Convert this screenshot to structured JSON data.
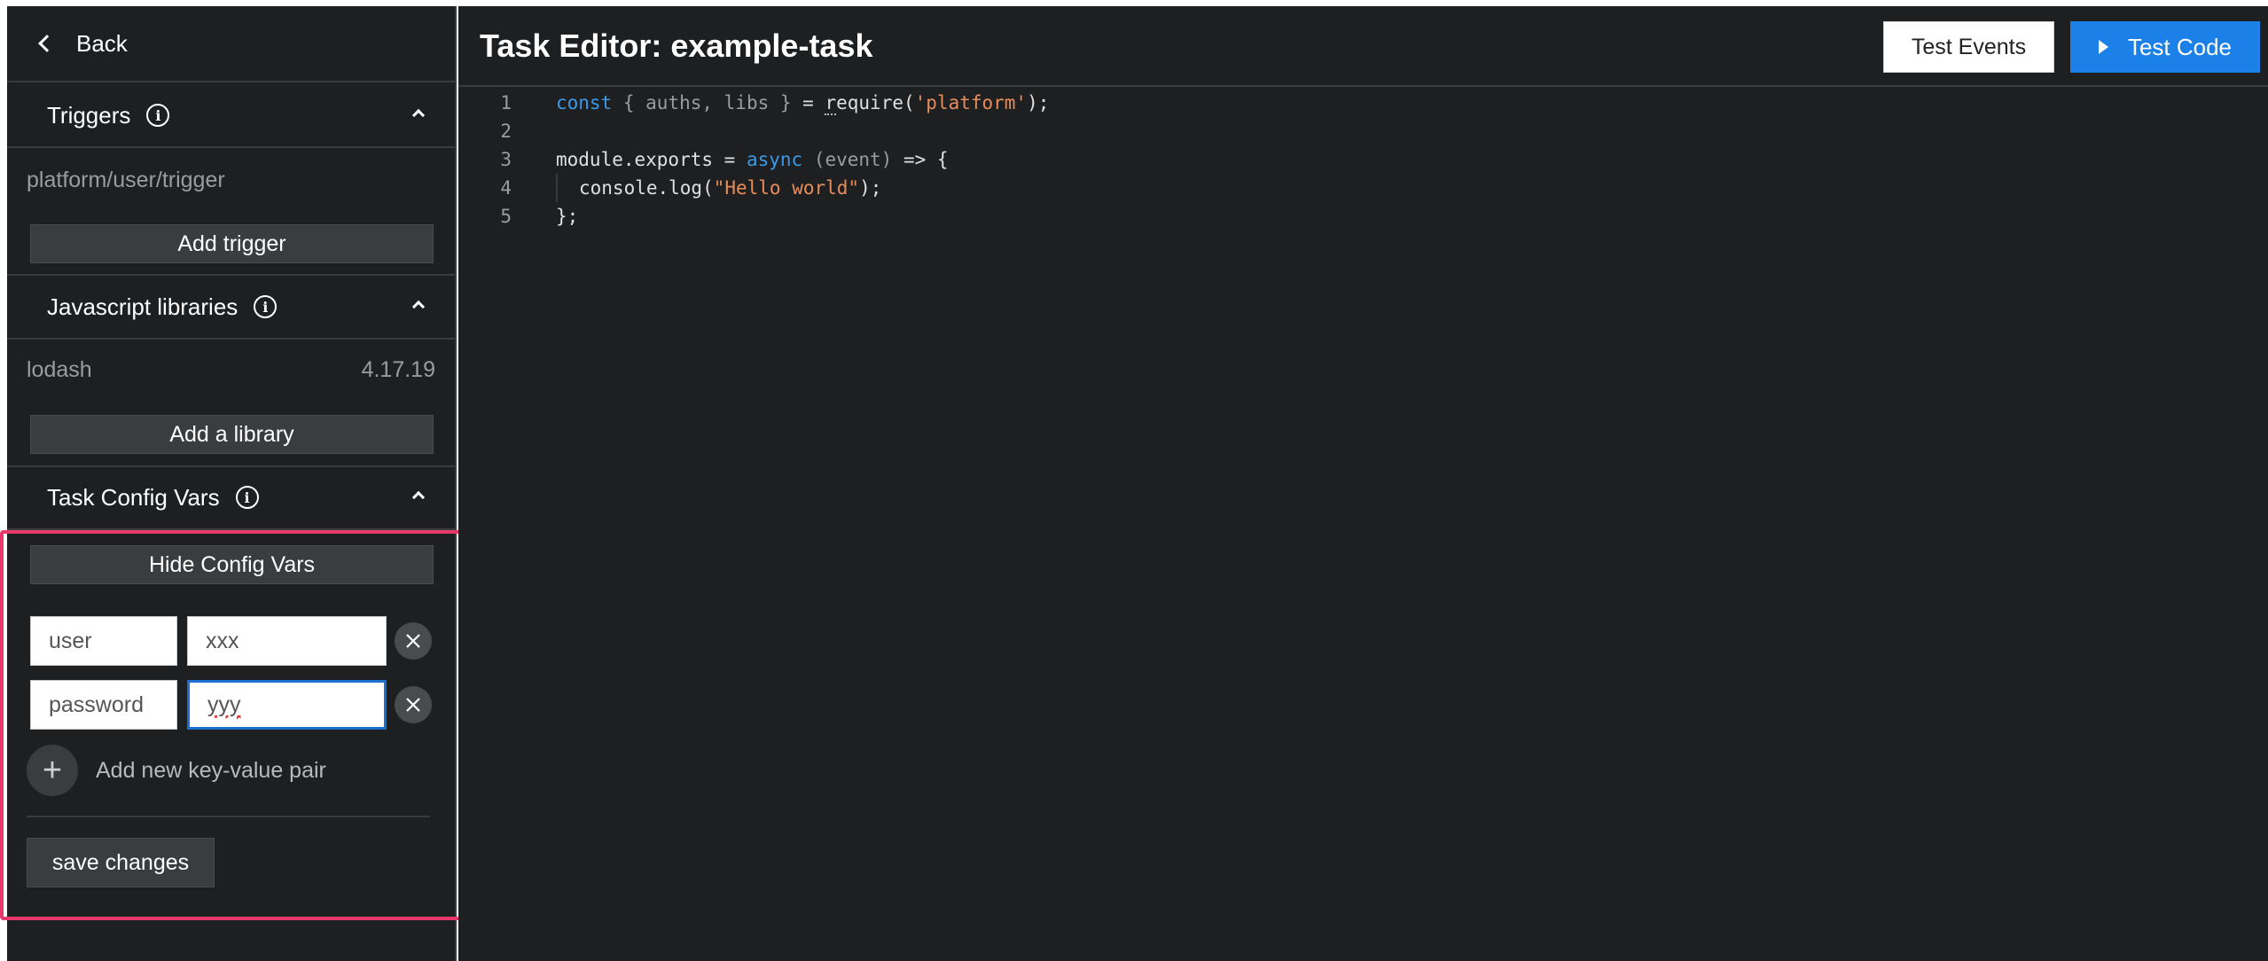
{
  "sidebar": {
    "back_label": "Back",
    "triggers": {
      "title": "Triggers",
      "items": [
        {
          "name": "platform/user/trigger"
        }
      ],
      "add_label": "Add trigger"
    },
    "libraries": {
      "title": "Javascript libraries",
      "items": [
        {
          "name": "lodash",
          "version": "4.17.19"
        }
      ],
      "add_label": "Add a library"
    },
    "config_vars": {
      "title": "Task Config Vars",
      "toggle_label": "Hide Config Vars",
      "pairs": [
        {
          "key": "user",
          "value": "xxx"
        },
        {
          "key": "password",
          "value": "yyy"
        }
      ],
      "add_pair_label": "Add new key-value pair",
      "save_label": "save changes"
    }
  },
  "header": {
    "title": "Task Editor: example-task",
    "test_events_label": "Test Events",
    "test_code_label": "Test Code"
  },
  "editor": {
    "line_numbers": [
      "1",
      "2",
      "3",
      "4",
      "5"
    ]
  },
  "colors": {
    "accent_blue": "#1b80e8",
    "highlight_border": "#e8386b",
    "background": "#1e1f21"
  }
}
